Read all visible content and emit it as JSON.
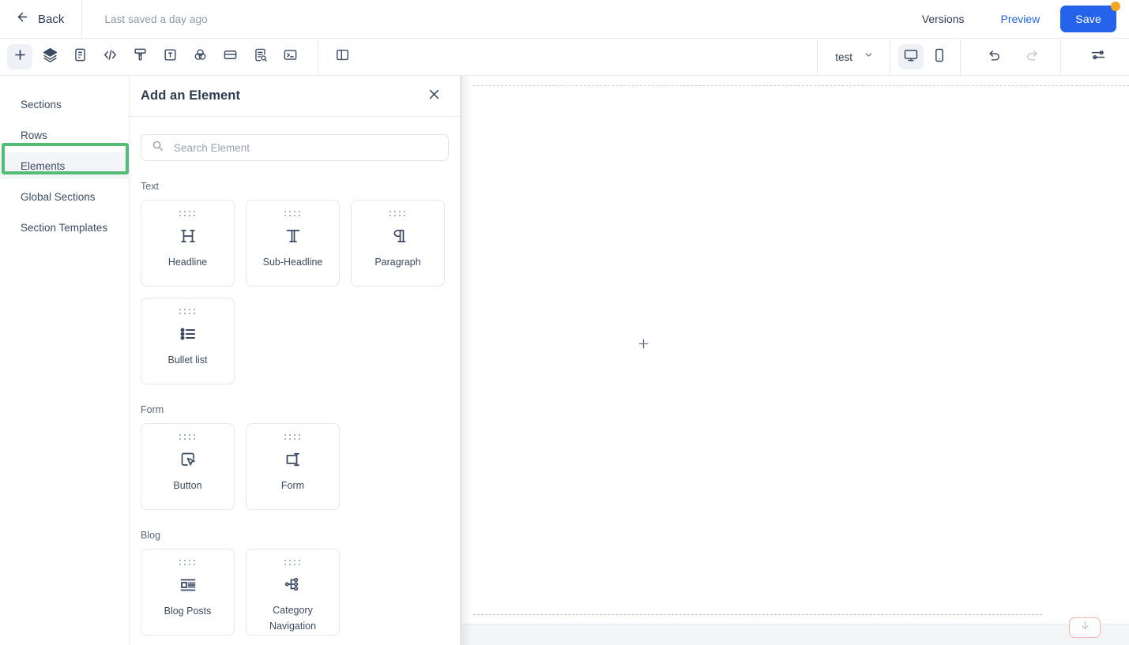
{
  "topbar": {
    "back_label": "Back",
    "back_icon": "arrow-left-icon",
    "saved_status": "Last saved a day ago",
    "versions_label": "Versions",
    "preview_label": "Preview",
    "save_label": "Save",
    "save_badge_color": "#f5a623",
    "preview_color": "#2563eb",
    "save_bg_color": "#2563eb"
  },
  "toolbar": {
    "tools": [
      {
        "name": "add-element-icon",
        "active": true
      },
      {
        "name": "layers-icon",
        "active": false
      },
      {
        "name": "page-document-icon",
        "active": false
      },
      {
        "name": "code-icon",
        "active": false
      },
      {
        "name": "brush-icon",
        "active": false
      },
      {
        "name": "typography-icon",
        "active": false
      },
      {
        "name": "color-palette-icon",
        "active": false
      },
      {
        "name": "card-icon",
        "active": false
      },
      {
        "name": "seo-document-search-icon",
        "active": false
      },
      {
        "name": "terminal-icon",
        "active": false
      }
    ],
    "panel_toggle_icon": "split-panel-icon",
    "page_name": "test",
    "page_chevron_icon": "chevron-down-icon",
    "devices": [
      {
        "name": "desktop-icon",
        "active": true
      },
      {
        "name": "mobile-icon",
        "active": false
      }
    ],
    "history": [
      {
        "name": "undo-icon",
        "enabled": true
      },
      {
        "name": "redo-icon",
        "enabled": false
      }
    ],
    "settings_icon": "sliders-icon"
  },
  "sidebar": {
    "items": [
      {
        "label": "Sections",
        "selected": false
      },
      {
        "label": "Rows",
        "selected": false
      },
      {
        "label": "Elements",
        "selected": true
      },
      {
        "label": "Global Sections",
        "selected": false
      },
      {
        "label": "Section Templates",
        "selected": false
      }
    ],
    "highlight_color": "#53bd76"
  },
  "panel": {
    "title": "Add an Element",
    "close_icon": "close-icon",
    "search": {
      "icon": "search-icon",
      "placeholder": "Search Element",
      "value": ""
    },
    "categories": [
      {
        "title": "Text",
        "elements": [
          {
            "label": "Headline",
            "icon": "headline-h-icon",
            "handle": "drag-dots"
          },
          {
            "label": "Sub-Headline",
            "icon": "subheadline-t-icon",
            "handle": "drag-dots"
          },
          {
            "label": "Paragraph",
            "icon": "paragraph-pilcrow-icon",
            "handle": "drag-dots"
          },
          {
            "label": "Bullet list",
            "icon": "bullet-list-icon",
            "handle": "drag-dots"
          }
        ]
      },
      {
        "title": "Form",
        "elements": [
          {
            "label": "Button",
            "icon": "button-cursor-icon",
            "handle": "drag-dots"
          },
          {
            "label": "Form",
            "icon": "form-input-icon",
            "handle": "drag-dots"
          }
        ]
      },
      {
        "title": "Blog",
        "elements": [
          {
            "label": "Blog Posts",
            "icon": "blog-posts-icon",
            "handle": "drag-dots"
          },
          {
            "label": "Category Navigation",
            "icon": "category-navigation-icon",
            "handle": "drag-dots"
          }
        ]
      }
    ]
  },
  "canvas": {
    "add_section_icon": "plus-icon",
    "scroll_badge_icon": "arrow-down-icon"
  }
}
